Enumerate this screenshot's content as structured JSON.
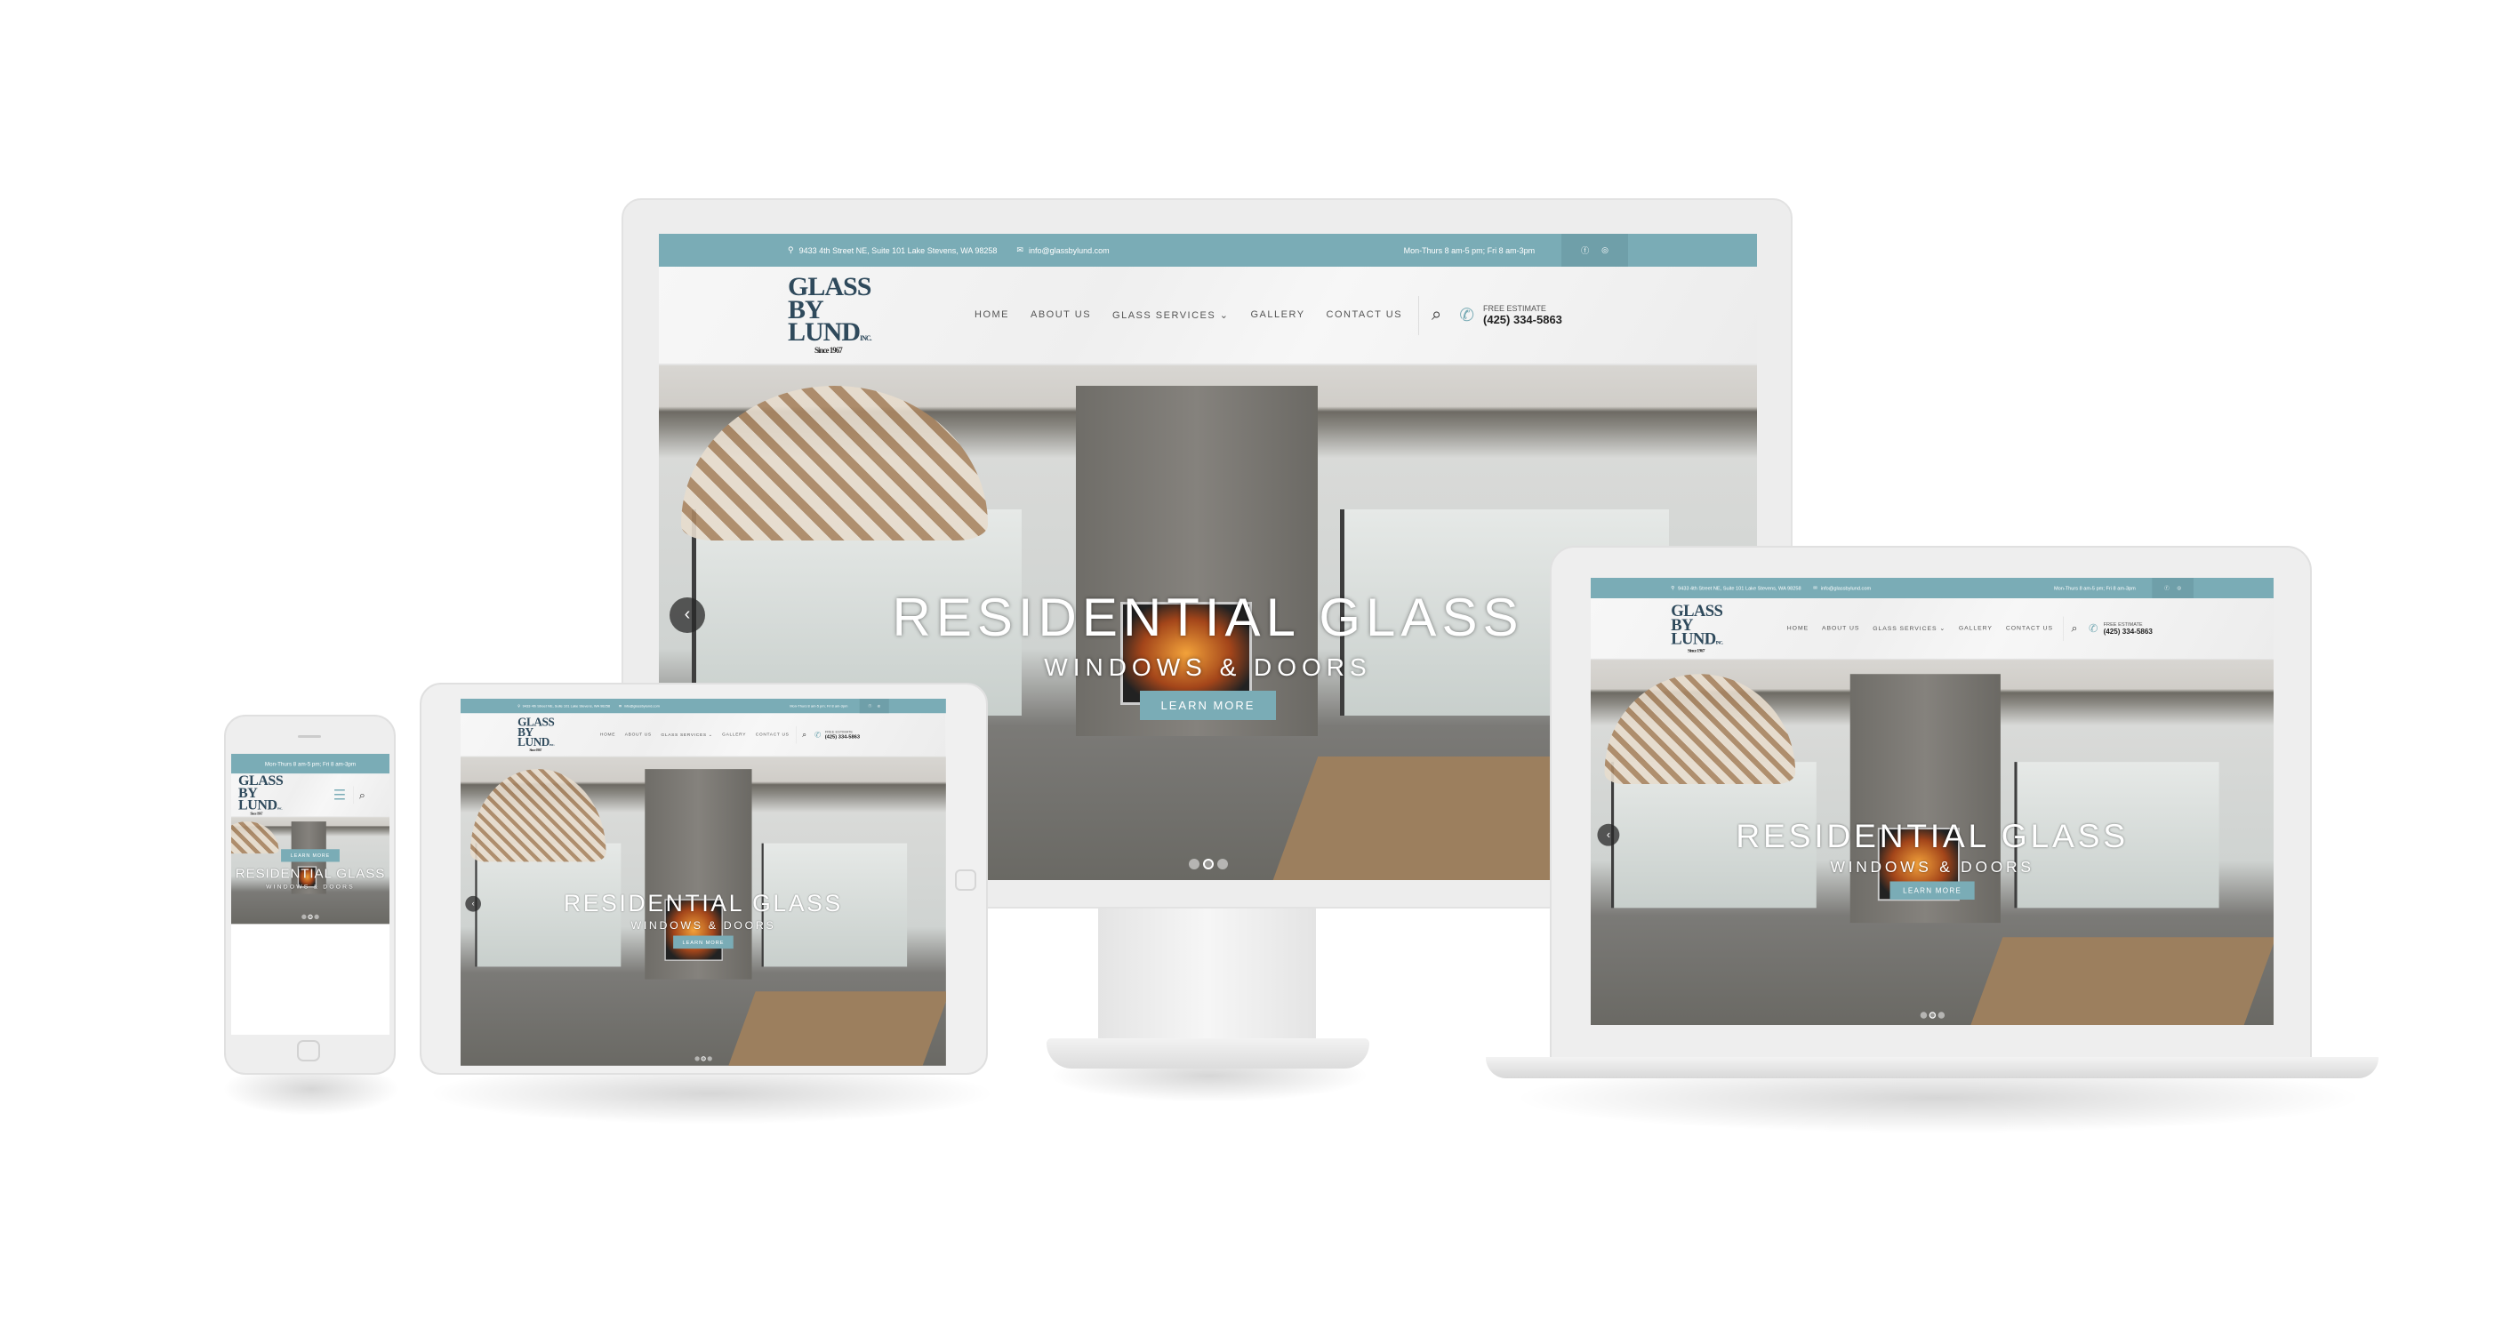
{
  "site": {
    "address": "9433 4th Street NE, Suite 101 Lake Stevens, WA 98258",
    "email": "info@glassbylund.com",
    "hours": "Mon-Thurs 8 am-5 pm; Fri 8 am-3pm",
    "logo": {
      "line1": "GLASS",
      "line2": "BY",
      "line3": "LUND",
      "suffix": "INC.",
      "since": "Since 1967"
    },
    "nav": [
      {
        "label": "HOME"
      },
      {
        "label": "ABOUT US"
      },
      {
        "label": "GLASS SERVICES ⌄"
      },
      {
        "label": "GALLERY"
      },
      {
        "label": "CONTACT US"
      }
    ],
    "estimate_label": "FREE ESTIMATE",
    "phone": "(425) 334-5863",
    "hero": {
      "title": "RESIDENTIAL GLASS",
      "subtitle": "WINDOWS & DOORS",
      "button": "LEARN MORE"
    },
    "colors": {
      "accent": "#7aacb6",
      "logo": "#2f4a5c"
    },
    "icons": [
      "map-pin-icon",
      "mail-icon",
      "facebook-icon",
      "instagram-icon",
      "search-icon",
      "phone-icon",
      "chevron-left-icon",
      "menu-icon"
    ]
  }
}
